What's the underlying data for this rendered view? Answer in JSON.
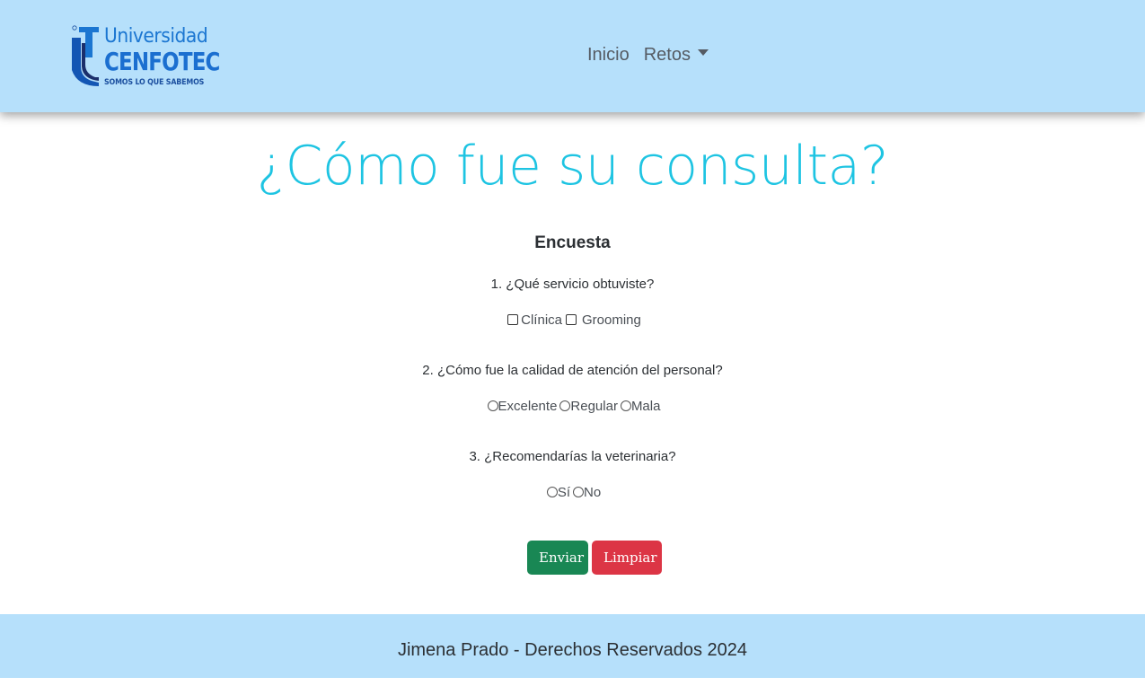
{
  "brand": {
    "line1": "Universidad",
    "line2": "CENFOTEC",
    "tagline": "SOMOS LO QUE SABEMOS",
    "color": "#1b6fd0"
  },
  "nav": {
    "items": [
      {
        "label": "Inicio"
      },
      {
        "label": "Retos",
        "dropdown": true
      }
    ]
  },
  "page": {
    "title": "¿Cómo fue su consulta?",
    "title_color": "#1ec4e2"
  },
  "survey": {
    "title": "Encuesta",
    "q1": {
      "text": "1. ¿Qué servicio obtuviste?",
      "options": [
        "Clínica",
        "Grooming"
      ]
    },
    "q2": {
      "text": "2. ¿Cómo fue la calidad de atención del personal?",
      "options": [
        "Excelente",
        "Regular",
        "Mala"
      ]
    },
    "q3": {
      "text": "3. ¿Recomendarías la veterinaria?",
      "options": [
        "Sí",
        "No"
      ]
    }
  },
  "actions": {
    "submit_label": "Enviar",
    "clear_label": "Limpiar",
    "submit_color": "#198754",
    "clear_color": "#dc3545"
  },
  "footer": {
    "text": "Jimena Prado - Derechos Reservados 2024"
  },
  "theme": {
    "header_bg": "#b6e0fb"
  }
}
